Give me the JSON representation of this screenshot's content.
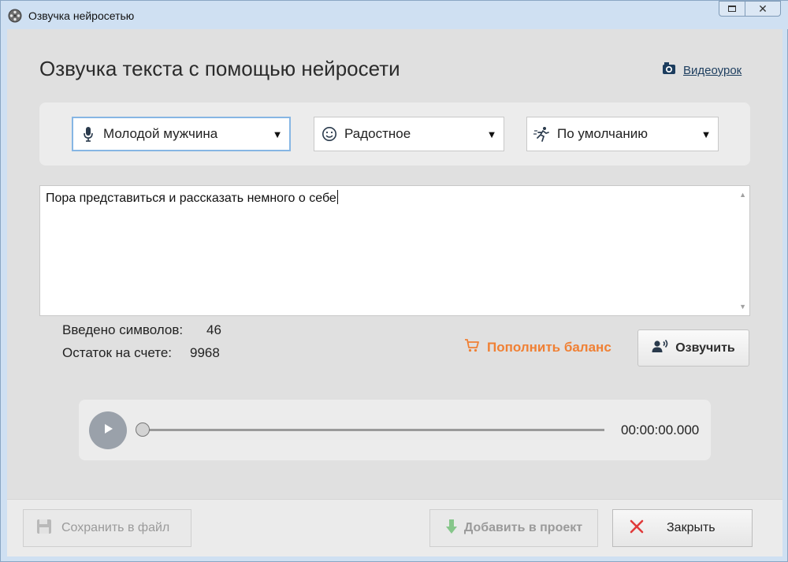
{
  "window": {
    "title": "Озвучка нейросетью"
  },
  "header": {
    "title": "Озвучка текста с помощью нейросети",
    "video_link": "Видеоурок"
  },
  "selectors": {
    "voice": {
      "value": "Молодой мужчина",
      "icon": "microphone-icon"
    },
    "mood": {
      "value": "Радостное",
      "icon": "smiley-icon"
    },
    "speed": {
      "value": "По умолчанию",
      "icon": "running-person-icon"
    }
  },
  "editor": {
    "text": "Пора представиться и рассказать немного о себе"
  },
  "stats": {
    "chars_label": "Введено символов:",
    "chars_value": "46",
    "balance_label": "Остаток на счете:",
    "balance_value": "9968"
  },
  "actions": {
    "refill_label": "Пополнить баланс",
    "voice_label": "Озвучить"
  },
  "player": {
    "time": "00:00:00.000",
    "progress": 0
  },
  "footer": {
    "save_label": "Сохранить в файл",
    "add_label": "Добавить в проект",
    "close_label": "Закрыть"
  },
  "colors": {
    "accent_orange": "#f08034",
    "close_red": "#e03a3a",
    "add_green": "#86c68a",
    "link_blue": "#1c3d5e"
  }
}
